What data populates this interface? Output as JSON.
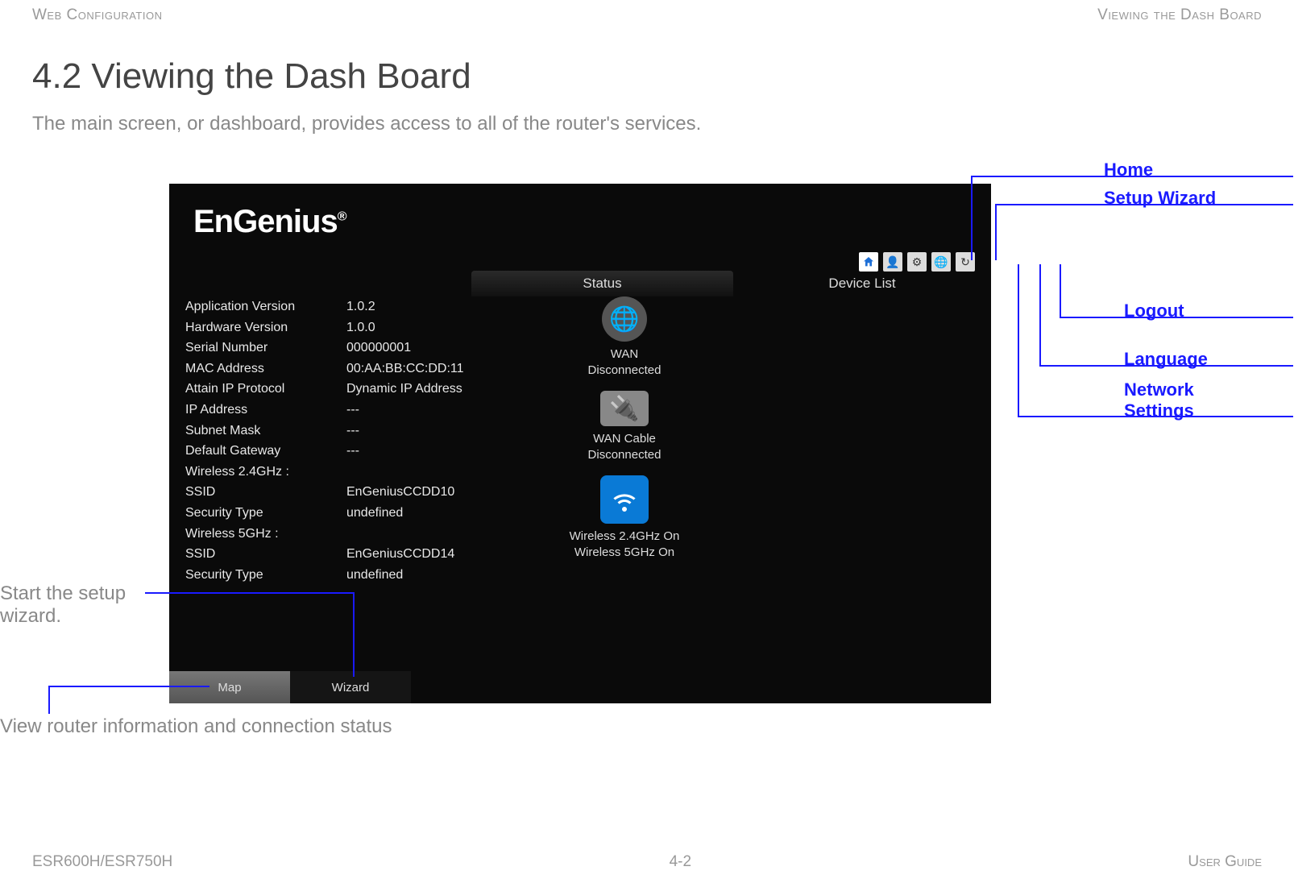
{
  "header": {
    "left": "Web Configuration",
    "right": "Viewing the Dash Board"
  },
  "section": {
    "number": "4.2",
    "title": "Viewing the Dash Board",
    "intro": "The main screen, or dashboard, provides access to all of the router's services."
  },
  "router": {
    "logo": "EnGenius",
    "columns": {
      "status": "Status",
      "device_list": "Device List"
    },
    "info": [
      {
        "k": "Application Version",
        "v": "1.0.2"
      },
      {
        "k": "Hardware Version",
        "v": "1.0.0"
      },
      {
        "k": "Serial Number",
        "v": "000000001"
      },
      {
        "k": "MAC Address",
        "v": "00:AA:BB:CC:DD:11"
      },
      {
        "k": "Attain IP Protocol",
        "v": "Dynamic IP Address"
      },
      {
        "k": "IP Address",
        "v": "---"
      },
      {
        "k": "Subnet Mask",
        "v": "---"
      },
      {
        "k": "Default Gateway",
        "v": "---"
      },
      {
        "k": "Wireless 2.4GHz :",
        "v": ""
      },
      {
        "k": "SSID",
        "v": "EnGeniusCCDD10"
      },
      {
        "k": "Security Type",
        "v": "undefined"
      },
      {
        "k": "Wireless 5GHz :",
        "v": ""
      },
      {
        "k": "SSID",
        "v": "EnGeniusCCDD14"
      },
      {
        "k": "Security Type",
        "v": "undefined"
      }
    ],
    "status_items": [
      {
        "label1": "WAN",
        "label2": "Disconnected",
        "icon": "globe"
      },
      {
        "label1": "WAN Cable",
        "label2": "Disconnected",
        "icon": "cable"
      },
      {
        "label1": "Wireless 2.4GHz On",
        "label2": "Wireless 5GHz On",
        "icon": "wifi"
      }
    ],
    "tabs": {
      "map": "Map",
      "wizard": "Wizard"
    },
    "icons": [
      "home-icon",
      "setup-wizard-icon",
      "network-settings-icon",
      "language-icon",
      "logout-icon"
    ]
  },
  "callouts": {
    "home": "Home",
    "setup_wizard": "Setup Wizard",
    "logout": "Logout",
    "language": "Language",
    "network_settings": "Network\nSettings",
    "start_wizard": "Start the setup wizard.",
    "view_info": "View router information and connection status"
  },
  "footer": {
    "left": "ESR600H/ESR750H",
    "center": "4-2",
    "right": "User Guide"
  }
}
